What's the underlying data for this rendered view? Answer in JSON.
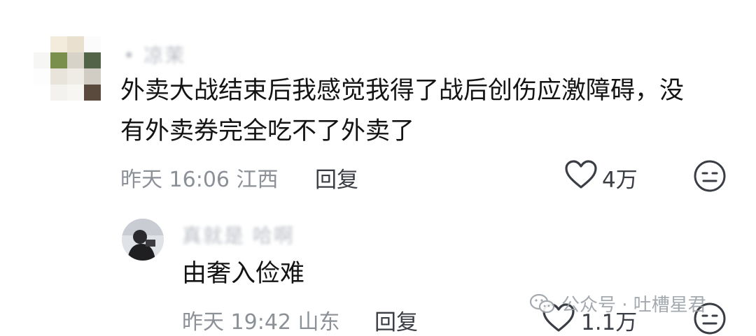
{
  "comments": [
    {
      "username": "• 凉茉",
      "text_line1": "外卖大战结束后我感觉我得了战后创伤应激障碍，没",
      "text_line2": "有外卖券完全吃不了外卖了",
      "meta": "昨天 16:06 江西",
      "reply_label": "回复",
      "likes": "4万"
    },
    {
      "username": "真就是 哈啊",
      "text": "由奢入俭难",
      "meta": "昨天 19:42 山东",
      "reply_label": "回复",
      "likes": "1.1万"
    }
  ],
  "watermark": {
    "text": "公众号 · 吐槽星君",
    "icon": "wechat-icon"
  },
  "icons": {
    "like": "heart-outline-icon",
    "dislike": "neutral-face-icon"
  },
  "colors": {
    "text": "#141414",
    "meta": "#8c9097",
    "icon": "#3a3d44",
    "background": "#ffffff"
  }
}
